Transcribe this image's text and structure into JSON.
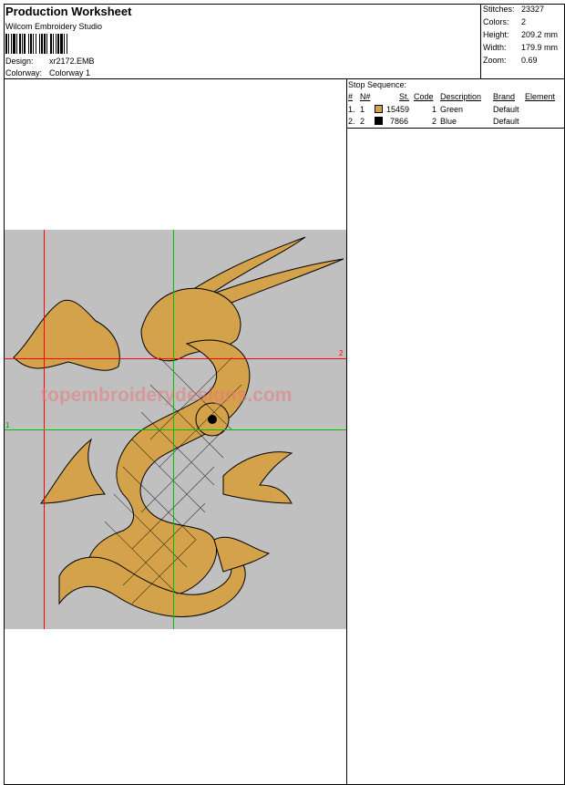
{
  "header": {
    "title": "Production Worksheet",
    "software": "Wilcom  Embroidery Studio",
    "design_label": "Design:",
    "design_value": "xr2172.EMB",
    "colorway_label": "Colorway:",
    "colorway_value": "Colorway 1"
  },
  "stats": [
    {
      "label": "Stitches:",
      "value": "23327"
    },
    {
      "label": "Colors:",
      "value": "2"
    },
    {
      "label": "Height:",
      "value": "209.2 mm"
    },
    {
      "label": "Width:",
      "value": "179.9 mm"
    },
    {
      "label": "Zoom:",
      "value": "0.69"
    }
  ],
  "stop_sequence": {
    "title": "Stop Sequence:",
    "headers": {
      "num": "#",
      "n": "N#",
      "st": "St.",
      "code": "Code",
      "description": "Description",
      "brand": "Brand",
      "element": "Element"
    },
    "rows": [
      {
        "num": "1.",
        "n": "1",
        "color": "#D4A24A",
        "st": "15459",
        "code": "1",
        "description": "Green",
        "brand": "Default"
      },
      {
        "num": "2.",
        "n": "2",
        "color": "#000000",
        "st": "7866",
        "code": "2",
        "description": "Blue",
        "brand": "Default"
      }
    ]
  },
  "preview": {
    "watermark": "topembroiderydesigns.com",
    "marker_1": "1",
    "marker_2": "2",
    "background": "#C0C0C0",
    "thread_color": "#D4A24A"
  }
}
